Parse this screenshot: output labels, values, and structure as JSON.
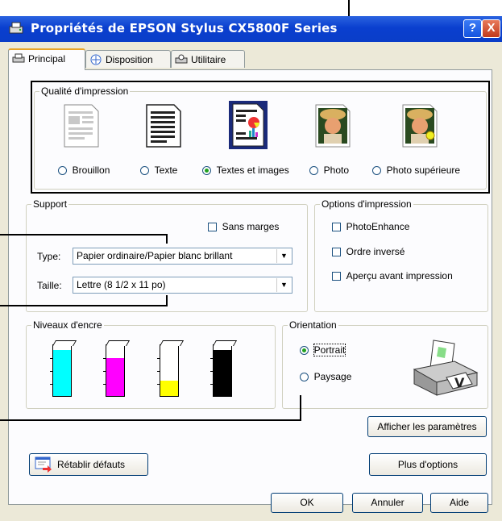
{
  "window": {
    "title": "Propriétés de EPSON Stylus CX5800F Series",
    "help_label": "?",
    "close_label": "X"
  },
  "tabs": [
    {
      "label": "Principal",
      "active": true
    },
    {
      "label": "Disposition",
      "active": false
    },
    {
      "label": "Utilitaire",
      "active": false
    }
  ],
  "quality": {
    "group_label": "Qualité d'impression",
    "options": [
      {
        "label": "Brouillon",
        "selected": false
      },
      {
        "label": "Texte",
        "selected": false
      },
      {
        "label": "Textes et images",
        "selected": true
      },
      {
        "label": "Photo",
        "selected": false
      },
      {
        "label": "Photo supérieure",
        "selected": false
      }
    ]
  },
  "support": {
    "group_label": "Support",
    "borderless_label": "Sans marges",
    "borderless_checked": false,
    "type_label": "Type:",
    "type_value": "Papier ordinaire/Papier blanc brillant",
    "size_label": "Taille:",
    "size_value": "Lettre (8 1/2 x 11 po)"
  },
  "print_options": {
    "group_label": "Options d'impression",
    "items": [
      {
        "label": "PhotoEnhance",
        "checked": false
      },
      {
        "label": "Ordre inversé",
        "checked": false
      },
      {
        "label": "Aperçu avant impression",
        "checked": false
      }
    ]
  },
  "ink": {
    "group_label": "Niveaux d'encre",
    "cartridges": [
      {
        "color_name": "cyan",
        "color": "#00ffff",
        "level": 0.9
      },
      {
        "color_name": "magenta",
        "color": "#ff00ff",
        "level": 0.75
      },
      {
        "color_name": "yellow",
        "color": "#ffff00",
        "level": 0.3
      },
      {
        "color_name": "black",
        "color": "#000000",
        "level": 0.9
      }
    ]
  },
  "orientation": {
    "group_label": "Orientation",
    "options": [
      {
        "label": "Portrait",
        "selected": true
      },
      {
        "label": "Paysage",
        "selected": false
      }
    ]
  },
  "buttons": {
    "show_settings": "Afficher les paramètres",
    "restore_defaults": "Rétablir défauts",
    "more_options": "Plus d'options",
    "ok": "OK",
    "cancel": "Annuler",
    "help": "Aide"
  },
  "colors": {
    "titlebar": "#0a3dc8",
    "dialog_bg": "#ece9d8",
    "panel_bg": "#fcfcfe"
  }
}
